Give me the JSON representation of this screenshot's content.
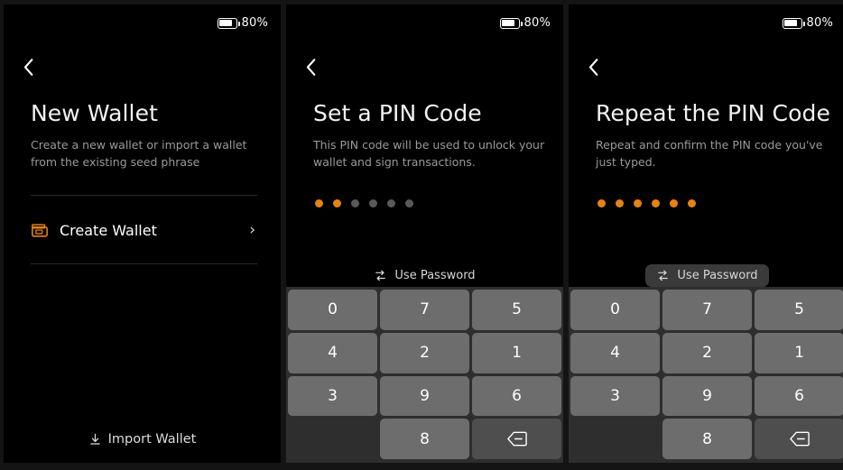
{
  "theme": {
    "accent": "#e8830c",
    "panel_bg": "#000000",
    "keypad_bg": "#2e2e2e",
    "key_bg": "#6d6d6d",
    "key_bg_dark": "#4e4e4e",
    "dot_off": "#595959",
    "text_primary": "#ffffff",
    "text_muted": "#9a9a9a"
  },
  "status": {
    "battery_label": "80%",
    "battery_level": 80,
    "battery_icon": "battery-icon"
  },
  "panels": [
    {
      "id": "new-wallet",
      "back_icon": "chevron-left-icon",
      "title": "New Wallet",
      "subtitle": "Create a new wallet or import a wallet from the existing seed phrase",
      "list": [
        {
          "icon": "wallet-icon",
          "label": "Create Wallet",
          "chevron": "›"
        }
      ],
      "footer": {
        "icon": "download-icon",
        "label": "Import Wallet"
      }
    },
    {
      "id": "set-pin",
      "back_icon": "chevron-left-icon",
      "title": "Set a PIN Code",
      "subtitle": "This PIN code will be used to unlock your wallet and sign transactions.",
      "pin": {
        "length": 6,
        "filled": 2
      },
      "use_password": {
        "icon": "swap-icon",
        "label": "Use Password",
        "hovered": false
      }
    },
    {
      "id": "repeat-pin",
      "back_icon": "chevron-left-icon",
      "title": "Repeat the PIN Code",
      "subtitle": "Repeat and confirm the PIN code you've just typed.",
      "pin": {
        "length": 6,
        "filled": 6
      },
      "use_password": {
        "icon": "swap-icon",
        "label": "Use Password",
        "hovered": true
      }
    }
  ],
  "keypad": {
    "keys": [
      {
        "label": "0",
        "type": "digit"
      },
      {
        "label": "7",
        "type": "digit"
      },
      {
        "label": "5",
        "type": "digit"
      },
      {
        "label": "4",
        "type": "digit"
      },
      {
        "label": "2",
        "type": "digit"
      },
      {
        "label": "1",
        "type": "digit"
      },
      {
        "label": "3",
        "type": "digit"
      },
      {
        "label": "9",
        "type": "digit"
      },
      {
        "label": "6",
        "type": "digit"
      },
      {
        "label": "",
        "type": "blank"
      },
      {
        "label": "8",
        "type": "digit"
      },
      {
        "label": "",
        "type": "backspace",
        "icon": "backspace-icon"
      }
    ]
  }
}
